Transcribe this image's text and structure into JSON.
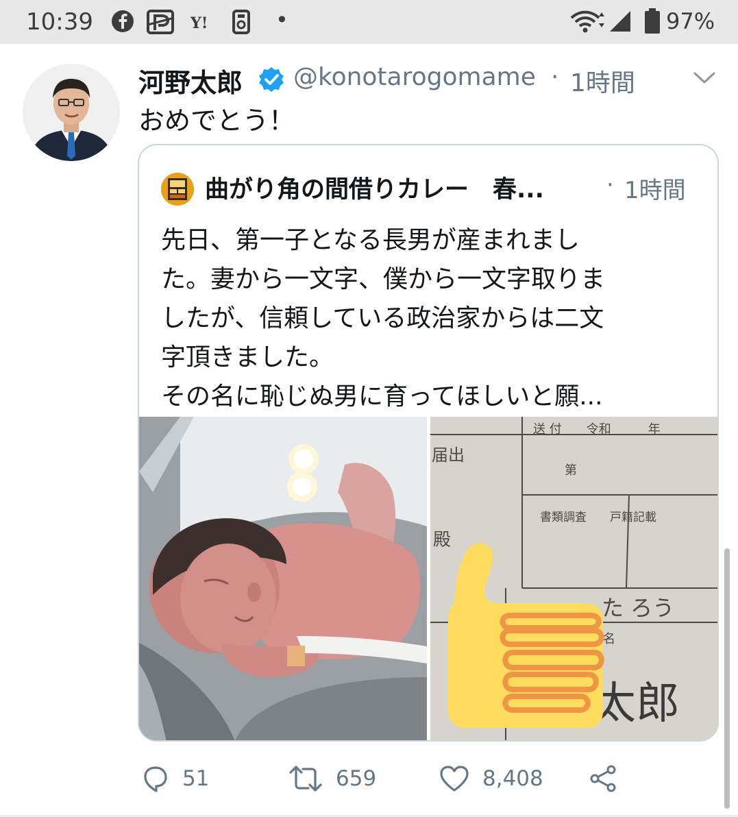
{
  "status_bar": {
    "time": "10:39",
    "notification_icons": [
      "facebook-icon",
      "paypay-icon",
      "yahoo-icon",
      "app-icon"
    ],
    "dot": "•",
    "battery": "97%"
  },
  "tweet": {
    "author_name": "河野太郎",
    "handle": "@konotarogomame",
    "separator": "·",
    "time": "1時間",
    "text": "おめでとう！",
    "quoted": {
      "author_name": "曲がり角の間借りカレー　春...",
      "separator": "·",
      "time": "1時間",
      "lines": [
        "先日、第一子となる長男が産まれまし",
        "た。妻から一文字、僕から一文字取りま",
        "したが、信頼している政治家からは二文",
        "字頂きました。",
        "その名に恥じぬ男に育ってほしいと願..."
      ],
      "document_image_text": {
        "line1": "送 付　　令和　　　年",
        "line2": "届出",
        "line3": "第",
        "line4": "書類調査　　戸籍記載",
        "line5": "殿",
        "line6": "た ろう",
        "line7": "名",
        "line8": "太郎"
      }
    },
    "actions": {
      "replies": "51",
      "retweets": "659",
      "likes": "8,408"
    }
  },
  "colors": {
    "accent": "#1da1f2",
    "secondary_text": "#657786",
    "primary_text": "#14171a",
    "border": "#ccd6dd",
    "thumb_fill": "#ffdc5d",
    "thumb_stroke": "#ef9645"
  }
}
